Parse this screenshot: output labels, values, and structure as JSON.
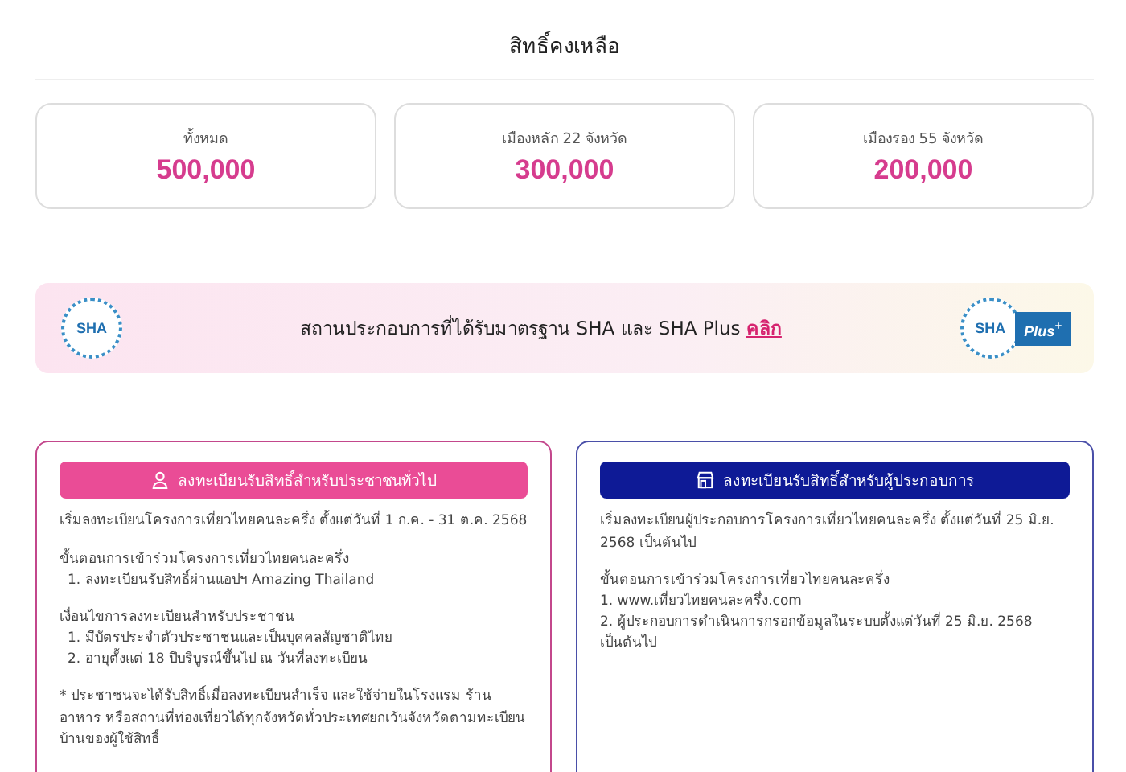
{
  "title": "สิทธิ์คงเหลือ",
  "stats": [
    {
      "label": "ทั้งหมด",
      "value": "500,000"
    },
    {
      "label": "เมืองหลัก 22 จังหวัด",
      "value": "300,000"
    },
    {
      "label": "เมืองรอง 55 จังหวัด",
      "value": "200,000"
    }
  ],
  "banner": {
    "text": "สถานประกอบการที่ได้รับมาตรฐาน SHA และ SHA Plus",
    "link": "คลิก",
    "logos": [
      {
        "kind": "sha",
        "text": "SHA"
      },
      {
        "kind": "sha_plus",
        "text": "SHA",
        "badge": "Plus$^{+}$"
      }
    ]
  },
  "cards": [
    {
      "kind": "public",
      "button": "ลงทะเบียนรับสิทธิ์สำหรับประชาชนทั่วไป",
      "blocks": [
        {
          "kind": "paragraph",
          "text": "เริ่มลงทะเบียนโครงการเที่ยวไทยคนละครึ่ง ตั้งแต่วันที่ 1 ก.ค. - 31 ต.ค. 2568"
        },
        {
          "kind": "list",
          "heading": "ขั้นตอนการเข้าร่วมโครงการเที่ยวไทยคนละครึ่ง",
          "items": [
            "1. ลงทะเบียนรับสิทธิ์ผ่านแอปฯ Amazing Thailand"
          ]
        },
        {
          "kind": "list",
          "heading": "เงื่อนไขการลงทะเบียนสำหรับประชาชน",
          "items": [
            "1. มีบัตรประจำตัวประชาชนและเป็นบุคคลสัญชาติไทย",
            "2. อายุตั้งแต่ 18 ปีบริบูรณ์ขึ้นไป ณ วันที่ลงทะเบียน"
          ]
        },
        {
          "kind": "note",
          "text": "* ประชาชนจะได้รับสิทธิ์เมื่อลงทะเบียนสำเร็จ และใช้จ่ายในโรงแรม ร้านอาหาร หรือสถานที่ท่องเที่ยวได้ทุกจังหวัดทั่วประเทศยกเว้นจังหวัดตามทะเบียนบ้านของผู้ใช้สิทธิ์"
        }
      ]
    },
    {
      "kind": "business",
      "button": "ลงทะเบียนรับสิทธิ์สำหรับผู้ประกอบการ",
      "blocks": [
        {
          "kind": "paragraph",
          "text": "เริ่มลงทะเบียนผู้ประกอบการโครงการเที่ยวไทยคนละครึ่ง ตั้งแต่วันที่ 25 มิ.ย. 2568 เป็นต้นไป"
        },
        {
          "kind": "list",
          "heading": "ขั้นตอนการเข้าร่วมโครงการเที่ยวไทยคนละครึ่ง",
          "items": [
            "1. www.เที่ยวไทยคนละครึ่ง.com",
            "2. ผู้ประกอบการดำเนินการกรอกข้อมูลในระบบตั้งแต่วันที่ 25 มิ.ย. 2568 เป็นต้นไป"
          ]
        }
      ]
    }
  ]
}
